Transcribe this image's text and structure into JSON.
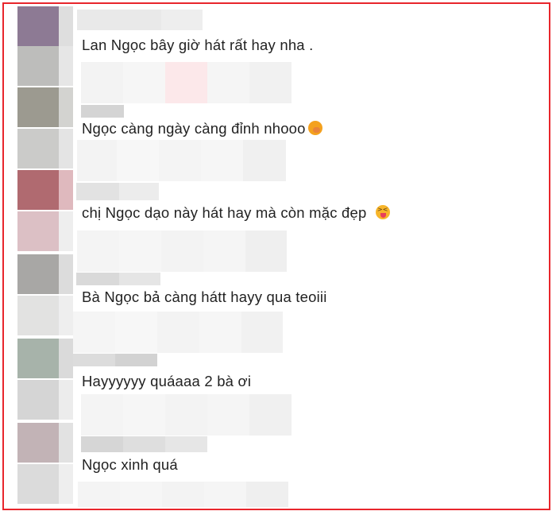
{
  "comments": [
    {
      "text": "Lan Ngọc bây giờ hát rất hay nha .",
      "emoji": ""
    },
    {
      "text": "Ngọc càng ngày càng đỉnh nhooo",
      "emoji": "hand-over-mouth-emoji"
    },
    {
      "text": "chị Ngọc dạo này hát hay mà còn mặc đẹp",
      "emoji": "squinting-tongue-emoji"
    },
    {
      "text": "Bà Ngọc bả càng hátt hayy qua teoiii",
      "emoji": ""
    },
    {
      "text": "Hayyyyyy quáaaa 2 bà ơi",
      "emoji": ""
    },
    {
      "text": "Ngọc xinh quá",
      "emoji": ""
    }
  ],
  "colors": {
    "frame": "#e8262c",
    "text": "#222222",
    "avatars": [
      "#8d7a94",
      "#bdbdbb",
      "#9c9a90",
      "#cbcbc9",
      "#b06a70",
      "#dcc0c5",
      "#a8a7a5",
      "#e2e2e1",
      "#a7b3aa",
      "#d5d5d5",
      "#c2b3b6",
      "#dbdbdb"
    ]
  }
}
